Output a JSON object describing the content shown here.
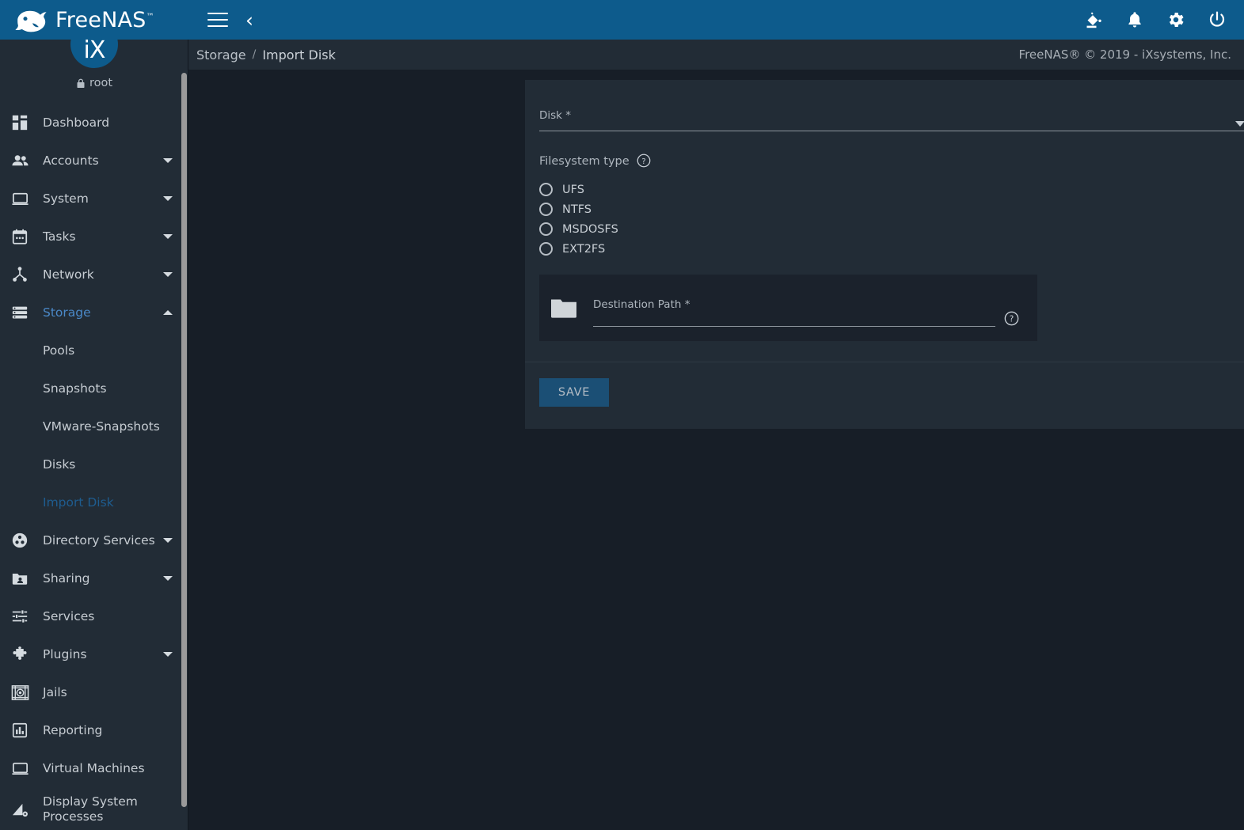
{
  "brand": {
    "name": "FreeNAS",
    "tm": "™",
    "logo_icon": "fish-logo-icon"
  },
  "user": {
    "avatar_text": "iX",
    "name": "root",
    "lock_icon": "lock-icon"
  },
  "topbar": {
    "menu_icon": "hamburger-menu-icon",
    "back_icon": "chevron-left-icon",
    "actions": [
      {
        "name": "theme-fill-icon",
        "label": "Change Theme"
      },
      {
        "name": "notifications-bell-icon",
        "label": "Notifications"
      },
      {
        "name": "settings-gear-icon",
        "label": "Settings"
      },
      {
        "name": "power-icon",
        "label": "Power"
      }
    ]
  },
  "breadcrumb": {
    "root": "Storage",
    "separator": "/",
    "current": "Import Disk",
    "copyright": "FreeNAS® © 2019 - iXsystems, Inc."
  },
  "sidebar": {
    "items": [
      {
        "label": "Dashboard",
        "icon": "dashboard-icon",
        "expandable": false
      },
      {
        "label": "Accounts",
        "icon": "accounts-people-icon",
        "expandable": true
      },
      {
        "label": "System",
        "icon": "system-monitor-icon",
        "expandable": true
      },
      {
        "label": "Tasks",
        "icon": "tasks-calendar-icon",
        "expandable": true
      },
      {
        "label": "Network",
        "icon": "network-nodes-icon",
        "expandable": true
      },
      {
        "label": "Storage",
        "icon": "storage-stack-icon",
        "expandable": true,
        "expanded": true,
        "active": true
      },
      {
        "label": "Directory Services",
        "icon": "directory-services-icon",
        "expandable": true
      },
      {
        "label": "Sharing",
        "icon": "sharing-folder-icon",
        "expandable": true
      },
      {
        "label": "Services",
        "icon": "services-sliders-icon",
        "expandable": false
      },
      {
        "label": "Plugins",
        "icon": "plugins-puzzle-icon",
        "expandable": true
      },
      {
        "label": "Jails",
        "icon": "jails-icon",
        "expandable": false
      },
      {
        "label": "Reporting",
        "icon": "reporting-chart-icon",
        "expandable": false
      },
      {
        "label": "Virtual Machines",
        "icon": "virtual-machines-icon",
        "expandable": false
      },
      {
        "label": "Display System Processes",
        "icon": "display-processes-icon",
        "expandable": false
      }
    ],
    "storage_children": [
      {
        "label": "Pools",
        "active": false
      },
      {
        "label": "Snapshots",
        "active": false
      },
      {
        "label": "VMware-Snapshots",
        "active": false
      },
      {
        "label": "Disks",
        "active": false
      },
      {
        "label": "Import Disk",
        "active": true
      }
    ]
  },
  "form": {
    "disk": {
      "label": "Disk",
      "required_mark": "*",
      "value": "",
      "dropdown_icon": "chevron-down-icon",
      "help_icon": "help-circle-icon"
    },
    "filesystem": {
      "label": "Filesystem type",
      "help_icon": "help-circle-icon",
      "selected": null,
      "options": [
        {
          "label": "UFS",
          "checked": false
        },
        {
          "label": "NTFS",
          "checked": false
        },
        {
          "label": "MSDOSFS",
          "checked": false
        },
        {
          "label": "EXT2FS",
          "checked": false
        }
      ]
    },
    "destination": {
      "label": "Destination Path",
      "required_mark": "*",
      "value": "",
      "folder_icon": "folder-icon",
      "help_icon": "help-circle-icon"
    },
    "save_label": "SAVE"
  },
  "colors": {
    "header_blue": "#0d5b8c",
    "page_bg": "#171e27",
    "panel_bg": "#222c36",
    "inner_panel_bg": "#1b222c",
    "accent_active": "#4a88c7",
    "accent_selected": "#1e5c8f",
    "save_button_bg": "#1b4f75"
  }
}
